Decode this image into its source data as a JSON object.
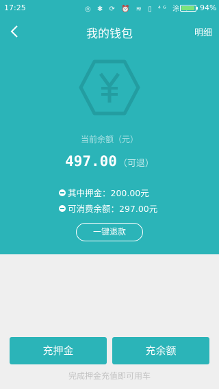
{
  "status": {
    "time": "17:25",
    "icons": "◎ ✱ ⟳ ⏰ ≋ ▯ ⁴ᴳ 涂 ⚡",
    "battery": "94%",
    "battery_level": 0.94
  },
  "header": {
    "title": "我的钱包",
    "detail_label": "明细"
  },
  "wallet": {
    "balance_label": "当前余额（元）",
    "balance": "497.00",
    "refundable": "（可退）",
    "deposit_line": "其中押金：200.00元",
    "spendable_line": "可消费余额：297.00元",
    "refund_button": "一键退款"
  },
  "actions": {
    "deposit_button": "充押金",
    "recharge_button": "充余额",
    "hint": "完成押金充值即可用车"
  },
  "colors": {
    "accent": "#2bb4b8",
    "background": "#efefef"
  }
}
